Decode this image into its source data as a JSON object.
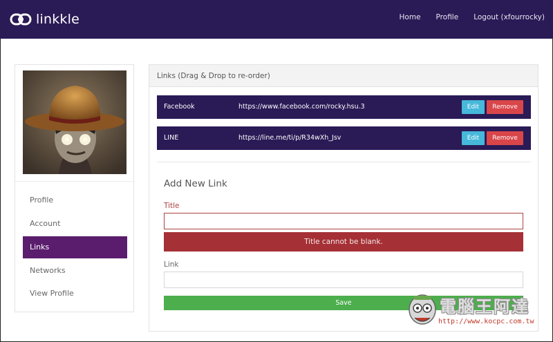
{
  "navbar": {
    "brand": "linkkle",
    "links": [
      "Home",
      "Profile",
      "Logout (xfourrocky)"
    ]
  },
  "sidebar": {
    "items": [
      {
        "label": "Profile",
        "active": false
      },
      {
        "label": "Account",
        "active": false
      },
      {
        "label": "Links",
        "active": true
      },
      {
        "label": "Networks",
        "active": false
      },
      {
        "label": "View Profile",
        "active": false
      }
    ]
  },
  "panel": {
    "heading": "Links (Drag & Drop to re-order)",
    "links": [
      {
        "title": "Facebook",
        "url": "https://www.facebook.com/rocky.hsu.3",
        "edit": "Edit",
        "remove": "Remove"
      },
      {
        "title": "LINE",
        "url": "https://line.me/ti/p/R34wXh_Jsv",
        "edit": "Edit",
        "remove": "Remove"
      }
    ]
  },
  "form": {
    "title": "Add New Link",
    "title_label": "Title",
    "title_value": "",
    "error": "Title cannot be blank.",
    "link_label": "Link",
    "link_value": "",
    "save": "Save"
  },
  "watermark": {
    "text": "電腦王阿達",
    "url": "http://www.kocpc.com.tw"
  },
  "colors": {
    "navbar": "#2a1a56",
    "active_item": "#5a1c6c",
    "edit": "#46b8da",
    "remove": "#d9464a",
    "error": "#a53035",
    "save": "#4cae4c"
  }
}
